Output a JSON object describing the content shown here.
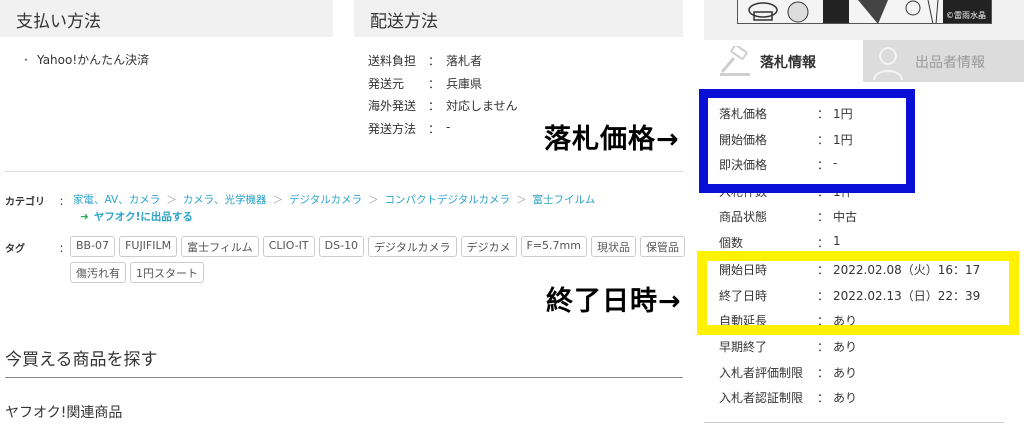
{
  "payment": {
    "title": "支払い方法",
    "bullet": "・",
    "method": "Yahoo!かんたん決済"
  },
  "shipping": {
    "title": "配送方法",
    "colon": "：",
    "rows": [
      {
        "key": "送料負担",
        "value": "落札者"
      },
      {
        "key": "発送元",
        "value": "兵庫県"
      },
      {
        "key": "海外発送",
        "value": "対応しません"
      },
      {
        "key": "発送方法",
        "value": "-"
      }
    ]
  },
  "category": {
    "label": "カテゴリ",
    "colon": "：",
    "separator": "＞",
    "crumbs": [
      "家電、AV、カメラ",
      "カメラ、光学機器",
      "デジタルカメラ",
      "コンパクトデジタルカメラ",
      "富士フイルム"
    ],
    "sell_arrow": "➜",
    "sell_link": "ヤフオク!に出品する"
  },
  "tags": {
    "label": "タグ",
    "colon": "：",
    "items": [
      "BB-07",
      "FUJIFILM",
      "富士フィルム",
      "CLIO-IT",
      "DS-10",
      "デジタルカメラ",
      "デジカメ",
      "F=5.7mm",
      "現状品",
      "保管品",
      "傷汚れ有",
      "1円スタート"
    ]
  },
  "find": {
    "title": "今買える商品を探す",
    "related": "ヤフオク!関連商品"
  },
  "thumbnail": {
    "credit": "©雷雨水晶"
  },
  "tabs": {
    "bid_info": "落札情報",
    "seller_info": "出品者情報"
  },
  "bid_info": {
    "colon": "：",
    "rows": [
      {
        "key": "落札価格",
        "value": "1円"
      },
      {
        "key": "開始価格",
        "value": "1円"
      },
      {
        "key": "即決価格",
        "value": "-"
      },
      {
        "key": "入札件数",
        "value": "1件"
      },
      {
        "key": "商品状態",
        "value": "中古"
      },
      {
        "key": "個数",
        "value": "1"
      },
      {
        "key": "開始日時",
        "value": "2022.02.08（火）16：17"
      },
      {
        "key": "終了日時",
        "value": "2022.02.13（日）22：39"
      },
      {
        "key": "自動延長",
        "value": "あり"
      },
      {
        "key": "早期終了",
        "value": "あり"
      },
      {
        "key": "入札者評価制限",
        "value": "あり"
      },
      {
        "key": "入札者認証制限",
        "value": "あり"
      }
    ]
  },
  "annotations": {
    "price": "落札価格→",
    "end": "終了日時→",
    "price_box_color": "#0a0fd6",
    "end_box_color": "#fff100"
  }
}
